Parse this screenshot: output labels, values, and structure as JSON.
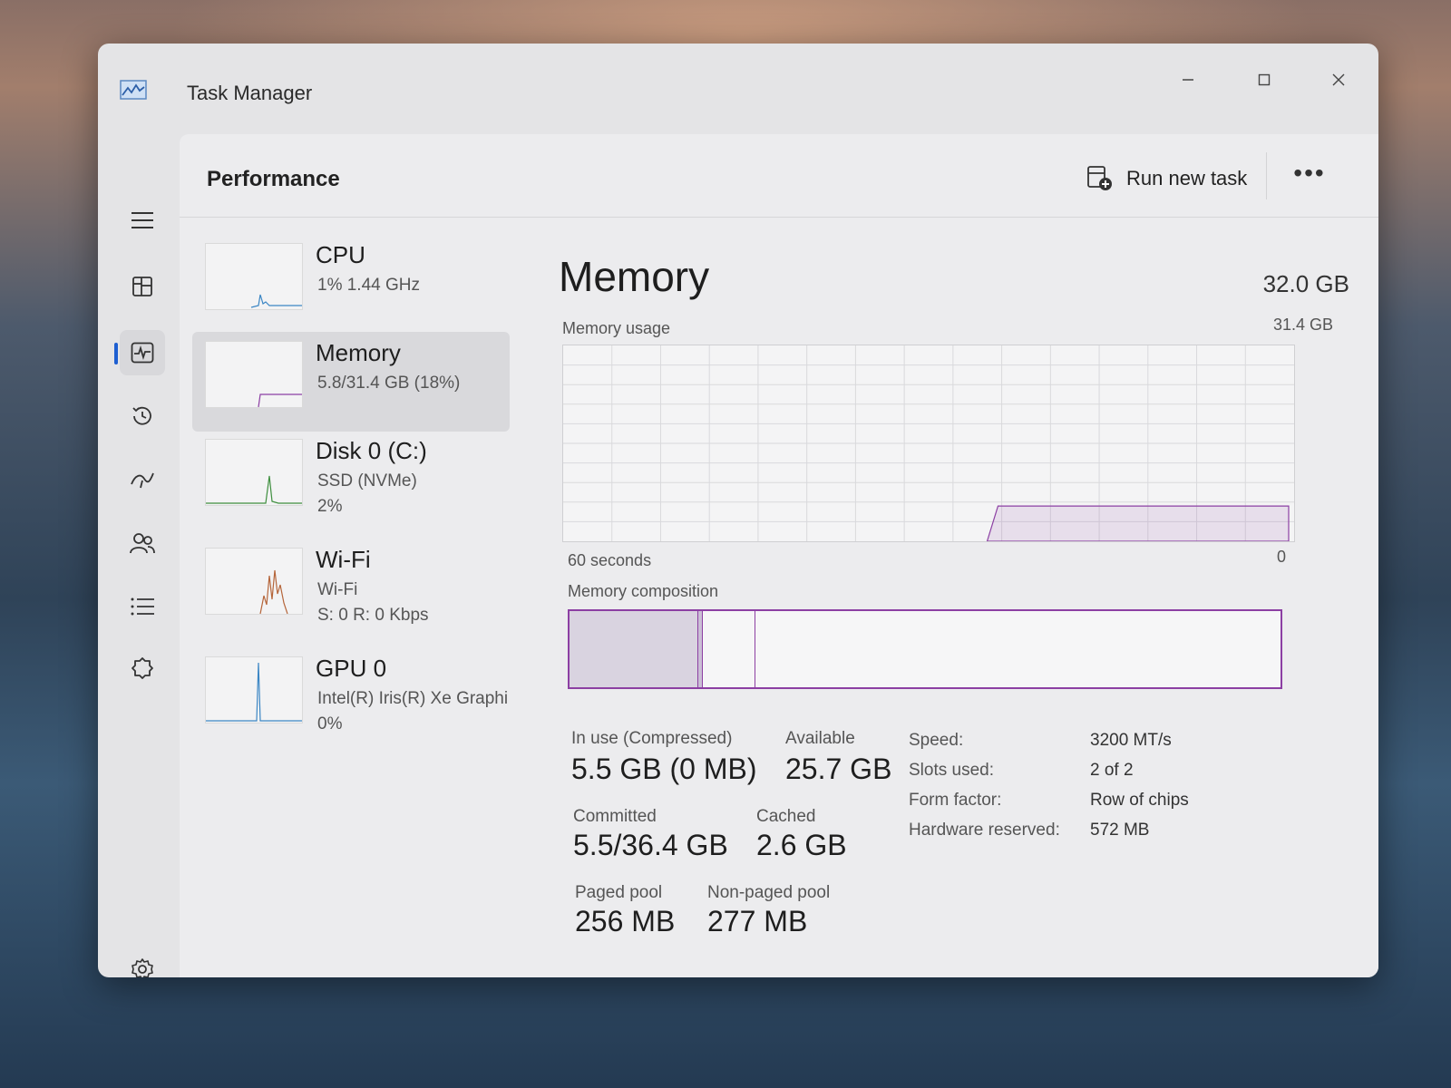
{
  "window": {
    "title": "Task Manager",
    "controls": {
      "minimize_icon": "minimize-icon",
      "maximize_icon": "maximize-icon",
      "close_icon": "close-icon"
    }
  },
  "nav": {
    "items": [
      {
        "id": "menu",
        "icon": "hamburger-icon"
      },
      {
        "id": "processes",
        "icon": "processes-icon"
      },
      {
        "id": "performance",
        "icon": "performance-icon",
        "active": true
      },
      {
        "id": "app-history",
        "icon": "history-icon"
      },
      {
        "id": "startup-apps",
        "icon": "startup-icon"
      },
      {
        "id": "users",
        "icon": "users-icon"
      },
      {
        "id": "details",
        "icon": "details-icon"
      },
      {
        "id": "services",
        "icon": "services-icon"
      },
      {
        "id": "settings",
        "icon": "settings-icon"
      }
    ],
    "active_color": "#1e5fd1"
  },
  "header": {
    "title": "Performance",
    "run_new_task": "Run new task",
    "more_icon": "more-options-icon"
  },
  "perf_list": [
    {
      "name": "CPU",
      "line1": "1%  1.44 GHz"
    },
    {
      "name": "Memory",
      "line1": "5.8/31.4 GB (18%)",
      "selected": true
    },
    {
      "name": "Disk 0 (C:)",
      "line1": "SSD (NVMe)",
      "line2": "2%"
    },
    {
      "name": "Wi-Fi",
      "line1": "Wi-Fi",
      "line2": "S: 0  R: 0 Kbps"
    },
    {
      "name": "GPU 0",
      "line1": "Intel(R) Iris(R) Xe Graphi",
      "line2": "0%"
    }
  ],
  "detail": {
    "title": "Memory",
    "total": "32.0 GB",
    "usage_label": "Memory usage",
    "usage_max": "31.4 GB",
    "time_label": "60 seconds",
    "zero_label": "0",
    "composition_label": "Memory composition",
    "composition": {
      "in_use_fraction": 0.18,
      "standby_end_fraction": 0.26
    },
    "usage_history": {
      "active_from_fraction": 0.58,
      "level_fraction": 0.18
    },
    "accent": "#8c3fa3",
    "stats": {
      "in_use_label": "In use (Compressed)",
      "in_use_value": "5.5 GB (0 MB)",
      "available_label": "Available",
      "available_value": "25.7 GB",
      "committed_label": "Committed",
      "committed_value": "5.5/36.4 GB",
      "cached_label": "Cached",
      "cached_value": "2.6 GB",
      "paged_label": "Paged pool",
      "paged_value": "256 MB",
      "nonpaged_label": "Non-paged pool",
      "nonpaged_value": "277 MB"
    },
    "specs": [
      {
        "key": "Speed:",
        "value": "3200 MT/s"
      },
      {
        "key": "Slots used:",
        "value": "2 of 2"
      },
      {
        "key": "Form factor:",
        "value": "Row of chips"
      },
      {
        "key": "Hardware reserved:",
        "value": "572 MB"
      }
    ]
  }
}
